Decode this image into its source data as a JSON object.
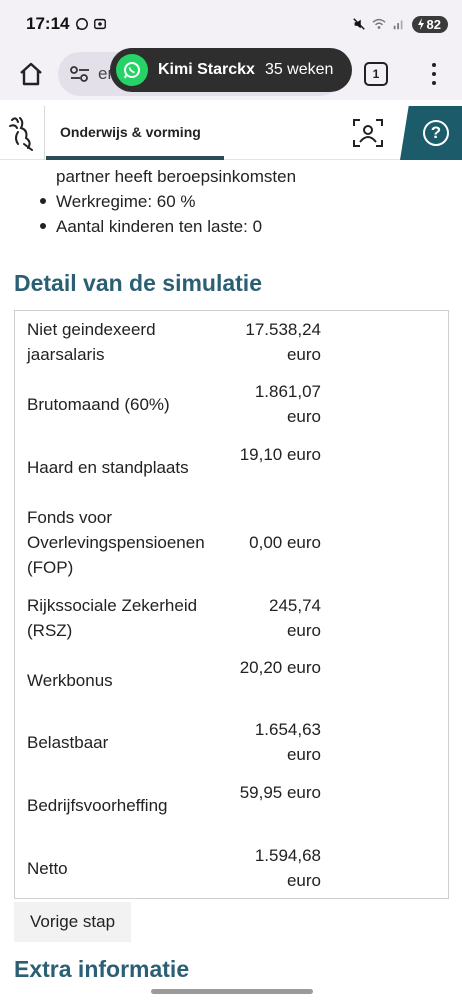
{
  "status_bar": {
    "time": "17:14",
    "battery": "82"
  },
  "browser": {
    "url_fragment": "er",
    "tab_count": "1"
  },
  "toast": {
    "contact": "Kimi Starckx",
    "detail": "35 weken"
  },
  "site": {
    "title": "Onderwijs & vorming",
    "help_label": "?"
  },
  "summary_items": {
    "continuation": "partner heeft beroepsinkomsten",
    "bullets": [
      "Werkregime: 60 %",
      "Aantal kinderen ten laste: 0"
    ]
  },
  "detail": {
    "title": "Detail van de simulatie",
    "rows": [
      {
        "label": "Niet geindexeerd jaarsalaris",
        "value": "17.538,24 euro"
      },
      {
        "label": "Brutomaand (60%)",
        "value": "1.861,07 euro"
      },
      {
        "label": "Haard en standplaats",
        "value": "19,10 euro"
      },
      {
        "label": "Fonds voor Overlevingspensioenen (FOP)",
        "value": "0,00 euro"
      },
      {
        "label": "Rijkssociale Zekerheid (RSZ)",
        "value": "245,74 euro"
      },
      {
        "label": "Werkbonus",
        "value": "20,20 euro"
      },
      {
        "label": "Belastbaar",
        "value": "1.654,63 euro"
      },
      {
        "label": "Bedrijfsvoorheffing",
        "value": "59,95 euro"
      },
      {
        "label": "Netto",
        "value": "1.594,68 euro"
      }
    ]
  },
  "prev_button": "Vorige stap",
  "extra": {
    "title": "Extra informatie"
  }
}
